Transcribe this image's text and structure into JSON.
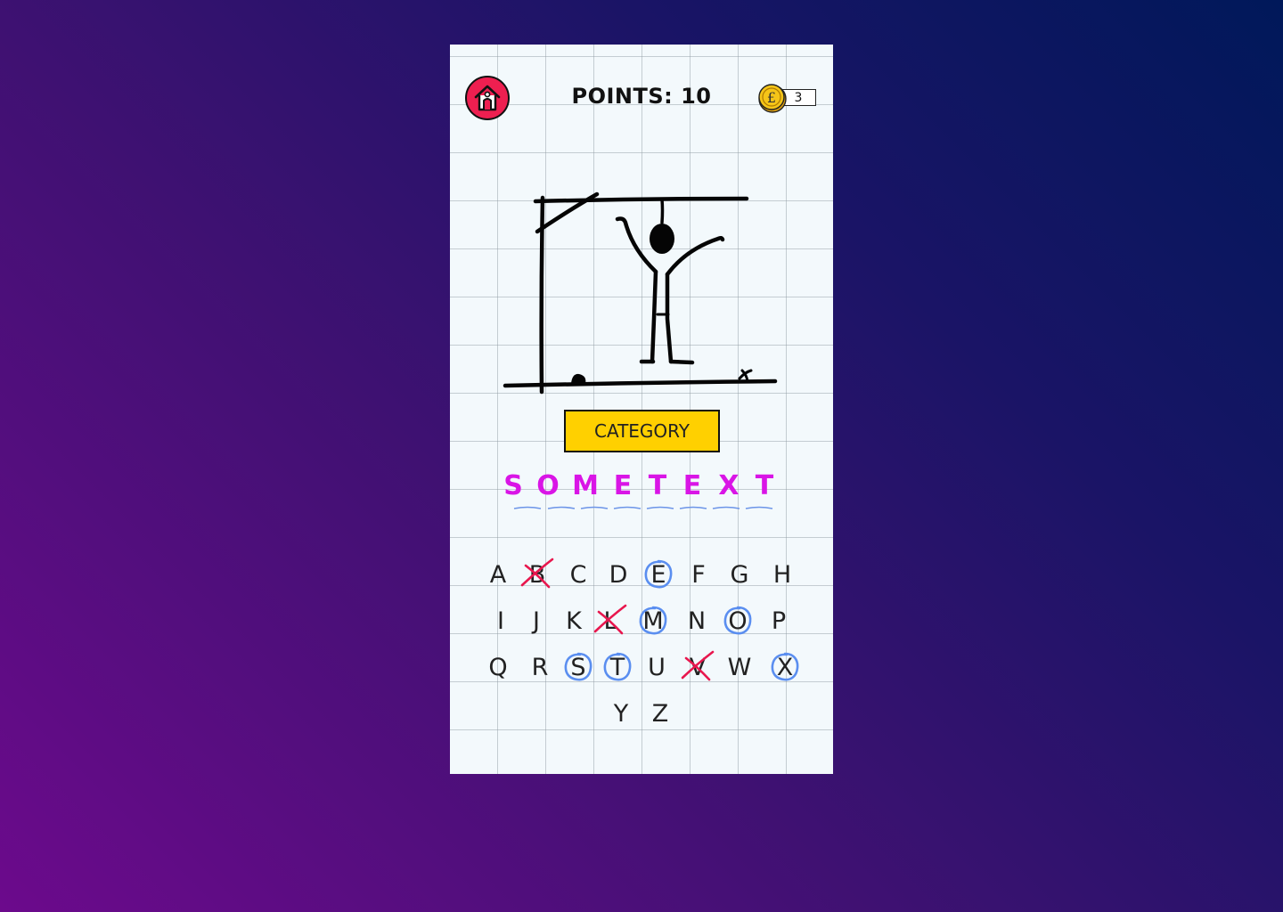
{
  "header": {
    "points_label": "POINTS: 10",
    "coins": "3",
    "coin_symbol": "£"
  },
  "icons": {
    "home": "home-icon",
    "coin": "coin-icon"
  },
  "category_label": "CATEGORY",
  "word": {
    "letters": [
      "S",
      "O",
      "M",
      "E",
      "T",
      "E",
      "X",
      "T"
    ]
  },
  "keyboard": {
    "keys": [
      {
        "letter": "A",
        "state": "unused"
      },
      {
        "letter": "B",
        "state": "wrong"
      },
      {
        "letter": "C",
        "state": "unused"
      },
      {
        "letter": "D",
        "state": "unused"
      },
      {
        "letter": "E",
        "state": "correct"
      },
      {
        "letter": "F",
        "state": "unused"
      },
      {
        "letter": "G",
        "state": "unused"
      },
      {
        "letter": "H",
        "state": "unused"
      },
      {
        "letter": "I",
        "state": "unused"
      },
      {
        "letter": "J",
        "state": "unused"
      },
      {
        "letter": "K",
        "state": "unused"
      },
      {
        "letter": "L",
        "state": "wrong"
      },
      {
        "letter": "M",
        "state": "correct"
      },
      {
        "letter": "N",
        "state": "unused"
      },
      {
        "letter": "O",
        "state": "correct"
      },
      {
        "letter": "P",
        "state": "unused"
      },
      {
        "letter": "Q",
        "state": "unused"
      },
      {
        "letter": "R",
        "state": "unused"
      },
      {
        "letter": "S",
        "state": "correct"
      },
      {
        "letter": "T",
        "state": "correct"
      },
      {
        "letter": "U",
        "state": "unused"
      },
      {
        "letter": "V",
        "state": "wrong"
      },
      {
        "letter": "W",
        "state": "unused"
      },
      {
        "letter": "X",
        "state": "correct"
      },
      {
        "letter": "Y",
        "state": "unused"
      },
      {
        "letter": "Z",
        "state": "unused"
      }
    ]
  },
  "colors": {
    "home_button": "#ee1f50",
    "category_bg": "#ffd000",
    "word_letter": "#d915e6",
    "correct_circle": "#5a8ef0",
    "wrong_cross": "#e8174e",
    "coin": "#f5c518"
  }
}
